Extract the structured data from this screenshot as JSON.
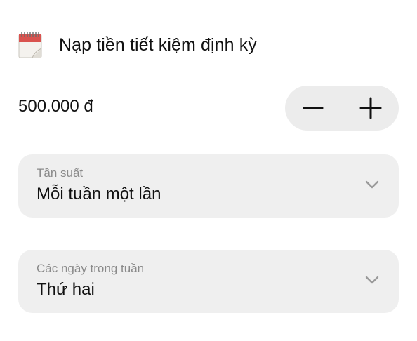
{
  "header": {
    "icon": "calendar-icon",
    "title": "Nạp tiền tiết kiệm định kỳ"
  },
  "amount": {
    "value": "500.000 đ",
    "decrement_icon": "minus-icon",
    "increment_icon": "plus-icon"
  },
  "frequency": {
    "label": "Tần suất",
    "value": "Mỗi tuần một lần",
    "icon": "chevron-down-icon"
  },
  "days": {
    "label": "Các ngày trong tuần",
    "value": "Thứ hai",
    "icon": "chevron-down-icon"
  },
  "colors": {
    "card_background": "#efefef",
    "stepper_background": "#ececec",
    "label_gray": "#8a8a8a",
    "text": "#111111"
  }
}
